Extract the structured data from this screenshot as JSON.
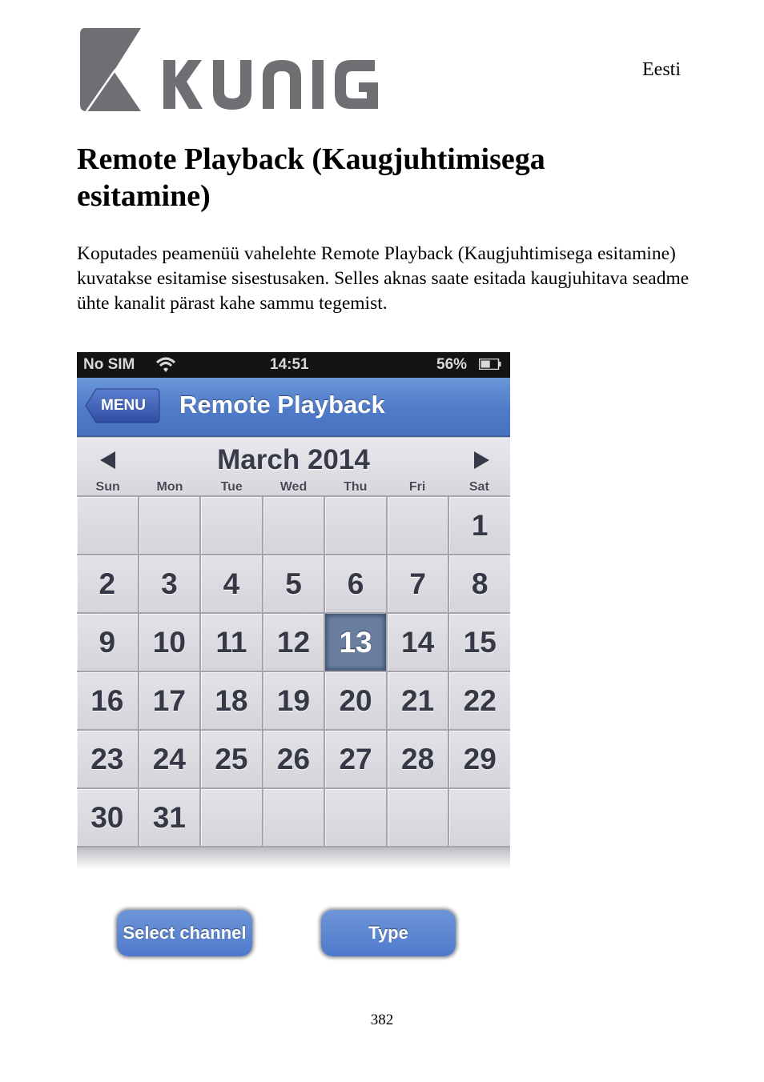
{
  "header": {
    "brand": "KÖNIG",
    "language": "Eesti"
  },
  "title": "Remote Playback (Kaugjuhtimisega esitamine)",
  "intro": "Koputades peamenüü vahelehte Remote Playback (Kaugjuhtimisega esitamine) kuvatakse esitamise sisestusaken. Selles aknas saate esitada kaugjuhitava seadme ühte kanalit pärast kahe sammu tegemist.",
  "phone": {
    "status_bar": {
      "carrier": "No SIM",
      "wifi_icon": "wifi-icon",
      "time": "14:51",
      "battery": "56%",
      "battery_level": 0.56
    },
    "nav": {
      "back_label": "MENU",
      "title": "Remote Playback",
      "accent": "#5582cc"
    },
    "calendar": {
      "month_label": "March 2014",
      "prev_icon": "triangle-left-icon",
      "next_icon": "triangle-right-icon",
      "weekdays": [
        "Sun",
        "Mon",
        "Tue",
        "Wed",
        "Thu",
        "Fri",
        "Sat"
      ],
      "weeks": [
        [
          "",
          "",
          "",
          "",
          "",
          "",
          "1"
        ],
        [
          "2",
          "3",
          "4",
          "5",
          "6",
          "7",
          "8"
        ],
        [
          "9",
          "10",
          "11",
          "12",
          "13",
          "14",
          "15"
        ],
        [
          "16",
          "17",
          "18",
          "19",
          "20",
          "21",
          "22"
        ],
        [
          "23",
          "24",
          "25",
          "26",
          "27",
          "28",
          "29"
        ],
        [
          "30",
          "31",
          "",
          "",
          "",
          "",
          ""
        ]
      ],
      "selected_day": "13",
      "selected_color": "#6a7f9f"
    }
  },
  "buttons": {
    "select_channel": "Select channel",
    "type": "Type"
  },
  "footer": {
    "page_number": "382"
  }
}
